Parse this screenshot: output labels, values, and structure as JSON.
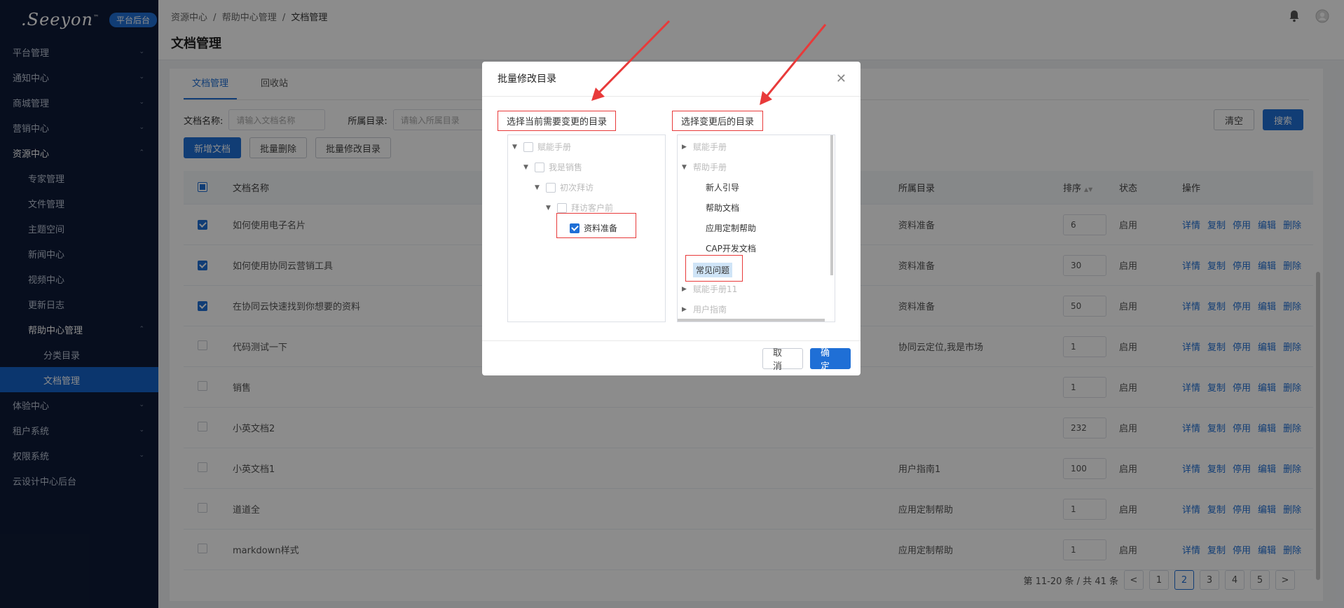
{
  "sidebar": {
    "logo": ".Seeyon",
    "logo_tm": "™",
    "badge": "平台后台",
    "items": [
      {
        "label": "平台管理"
      },
      {
        "label": "通知中心"
      },
      {
        "label": "商城管理"
      },
      {
        "label": "营销中心"
      },
      {
        "label": "资源中心"
      },
      {
        "label": "专家管理"
      },
      {
        "label": "文件管理"
      },
      {
        "label": "主题空间"
      },
      {
        "label": "新闻中心"
      },
      {
        "label": "视频中心"
      },
      {
        "label": "更新日志"
      },
      {
        "label": "帮助中心管理"
      },
      {
        "label": "分类目录"
      },
      {
        "label": "文档管理"
      },
      {
        "label": "体验中心"
      },
      {
        "label": "租户系统"
      },
      {
        "label": "权限系统"
      },
      {
        "label": "云设计中心后台"
      }
    ]
  },
  "header": {
    "breadcrumb": [
      "资源中心",
      "/",
      "帮助中心管理",
      "/",
      "文档管理"
    ],
    "title": "文档管理"
  },
  "tabs": [
    "文档管理",
    "回收站"
  ],
  "filter": {
    "name_label": "文档名称:",
    "name_placeholder": "请输入文档名称",
    "dir_label": "所属目录:",
    "dir_placeholder": "请输入所属目录",
    "clear": "清空",
    "search": "搜索"
  },
  "actions": {
    "add": "新增文档",
    "batch_delete": "批量删除",
    "batch_modify": "批量修改目录"
  },
  "table": {
    "headers": {
      "name": "文档名称",
      "dir": "所属目录",
      "sort": "排序",
      "status": "状态",
      "ops": "操作"
    },
    "ops": [
      "详情",
      "复制",
      "停用",
      "编辑",
      "删除"
    ],
    "rows": [
      {
        "name": "如何使用电子名片",
        "dir": "资料准备",
        "sort": "6",
        "status": "启用",
        "checked": true
      },
      {
        "name": "如何使用协同云营销工具",
        "dir": "资料准备",
        "sort": "30",
        "status": "启用",
        "checked": true
      },
      {
        "name": "在协同云快速找到你想要的资料",
        "dir": "资料准备",
        "sort": "50",
        "status": "启用",
        "checked": true
      },
      {
        "name": "代码测试一下",
        "dir": "协同云定位,我是市场",
        "sort": "1",
        "status": "启用",
        "checked": false
      },
      {
        "name": "销售",
        "dir": "",
        "sort": "1",
        "status": "启用",
        "checked": false
      },
      {
        "name": "小英文档2",
        "dir": "",
        "sort": "232",
        "status": "启用",
        "checked": false
      },
      {
        "name": "小英文档1",
        "dir": "用户指南1",
        "sort": "100",
        "status": "启用",
        "checked": false
      },
      {
        "name": "道道全",
        "dir": "应用定制帮助",
        "sort": "1",
        "status": "启用",
        "checked": false
      },
      {
        "name": "markdown样式",
        "dir": "应用定制帮助",
        "sort": "1",
        "status": "启用",
        "checked": false
      }
    ]
  },
  "pagination": {
    "summary": "第 11-20 条 / 共 41 条",
    "prev": "<",
    "next": ">",
    "pages": [
      "1",
      "2",
      "3",
      "4",
      "5"
    ],
    "current": "2"
  },
  "modal": {
    "title": "批量修改目录",
    "left_label": "选择当前需要变更的目录",
    "right_label": "选择变更后的目录",
    "left_tree": [
      "赋能手册",
      "我是销售",
      "初次拜访",
      "拜访客户前",
      "资料准备"
    ],
    "right_tree": [
      "赋能手册",
      "帮助手册",
      "新人引导",
      "帮助文档",
      "应用定制帮助",
      "CAP开发文档",
      "常见问题",
      "赋能手册11",
      "用户指南"
    ],
    "cancel": "取 消",
    "confirm": "确 定"
  },
  "colors": {
    "primary": "#1f6fd6",
    "sidebar_bg": "#0e1b37",
    "annotation_red": "#e83a3a"
  }
}
